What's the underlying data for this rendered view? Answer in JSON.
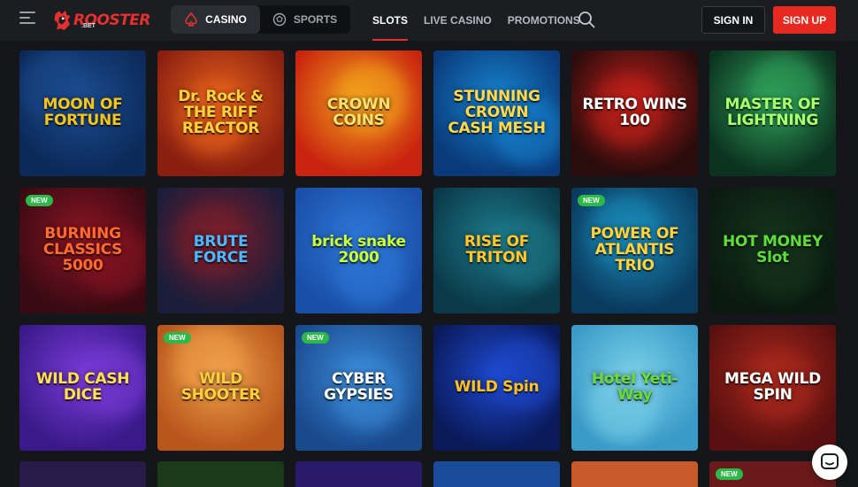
{
  "header": {
    "logo_text": "ROOSTER",
    "logo_sub": ".BET",
    "modes": [
      {
        "label": "CASINO",
        "active": true
      },
      {
        "label": "SPORTS",
        "active": false
      }
    ],
    "nav": [
      {
        "label": "SLOTS",
        "active": true
      },
      {
        "label": "LIVE CASINO",
        "active": false
      },
      {
        "label": "PROMOTIONS",
        "active": false
      }
    ],
    "sign_in": "SIGN IN",
    "sign_up": "SIGN UP"
  },
  "badge_label": "NEW",
  "games": [
    {
      "title": "MOON OF FORTUNE",
      "new": false,
      "bg": "#0b2a5a",
      "bg2": "#1d4c8f",
      "color": "#f5c518"
    },
    {
      "title": "Dr. Rock & THE RIFF REACTOR",
      "new": false,
      "bg": "#8a1f10",
      "bg2": "#e8621c",
      "color": "#ffd23a"
    },
    {
      "title": "CROWN COINS",
      "new": false,
      "bg": "#c9240f",
      "bg2": "#f2a21c",
      "color": "#ffe06b"
    },
    {
      "title": "STUNNING CROWN CASH MESH",
      "new": false,
      "bg": "#0a3a7a",
      "bg2": "#1785d1",
      "color": "#ffd84a"
    },
    {
      "title": "RETRO WINS 100",
      "new": false,
      "bg": "#2a0c0c",
      "bg2": "#c1201a",
      "color": "#ffffff"
    },
    {
      "title": "MASTER OF LIGHTNING",
      "new": false,
      "bg": "#0c3320",
      "bg2": "#2fa05a",
      "color": "#a8ff6a"
    },
    {
      "title": "BURNING CLASSICS 5000",
      "new": true,
      "bg": "#3a0a12",
      "bg2": "#8e1526",
      "color": "#ff6a2a"
    },
    {
      "title": "BRUTE FORCE",
      "new": false,
      "bg": "#1c1d3a",
      "bg2": "#7a1e2a",
      "color": "#4ab8ff"
    },
    {
      "title": "brick snake 2000",
      "new": false,
      "bg": "#1a4fa8",
      "bg2": "#2e78d8",
      "color": "#c8ff3a"
    },
    {
      "title": "RISE OF TRITON",
      "new": false,
      "bg": "#0a3a4a",
      "bg2": "#1d7a8a",
      "color": "#ffc62a"
    },
    {
      "title": "POWER OF ATLANTIS TRIO",
      "new": true,
      "bg": "#0a3a5e",
      "bg2": "#1a8ab8",
      "color": "#ffd23a"
    },
    {
      "title": "HOT MONEY Slot",
      "new": false,
      "bg": "#0a1a10",
      "bg2": "#15341c",
      "color": "#5ddc3a"
    },
    {
      "title": "WILD CASH DICE",
      "new": false,
      "bg": "#3a1a8a",
      "bg2": "#7a3ad8",
      "color": "#ffe14a"
    },
    {
      "title": "WILD SHOOTER",
      "new": true,
      "bg": "#b8561c",
      "bg2": "#f0a04a",
      "color": "#ffcf3a"
    },
    {
      "title": "CYBER GYPSIES",
      "new": true,
      "bg": "#1a4a8e",
      "bg2": "#3a8ad8",
      "color": "#ffffff"
    },
    {
      "title": "WILD Spin",
      "new": false,
      "bg": "#0a1a5a",
      "bg2": "#1e4ad0",
      "color": "#ffc21a"
    },
    {
      "title": "Hotel Yeti-Way",
      "new": false,
      "bg": "#3a9ac8",
      "bg2": "#7ad0e8",
      "color": "#6adc3a"
    },
    {
      "title": "MEGA WILD SPIN",
      "new": false,
      "bg": "#5a1010",
      "bg2": "#a8281c",
      "color": "#ffffff"
    }
  ],
  "partial_row": [
    {
      "bg": "#2a1a4a",
      "new": false
    },
    {
      "bg": "#1a3a1a",
      "new": false
    },
    {
      "bg": "#2a1a6a",
      "new": false
    },
    {
      "bg": "#1a4a9a",
      "new": false
    },
    {
      "bg": "#c85a2a",
      "new": false
    },
    {
      "bg": "#6a1a1a",
      "new": true
    }
  ]
}
